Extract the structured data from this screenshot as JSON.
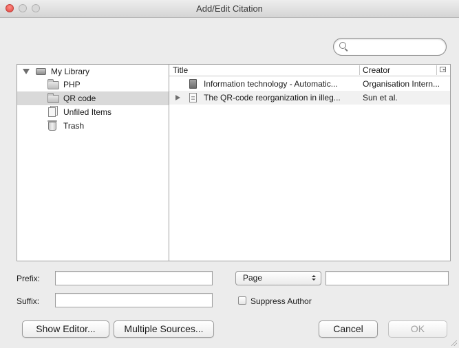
{
  "window": {
    "title": "Add/Edit Citation"
  },
  "search": {
    "value": "",
    "placeholder": ""
  },
  "library_tree": {
    "root": {
      "label": "My Library",
      "icon": "library-icon"
    },
    "items": [
      {
        "label": "PHP",
        "icon": "folder-icon",
        "selected": false
      },
      {
        "label": "QR code",
        "icon": "folder-icon",
        "selected": true
      },
      {
        "label": "Unfiled Items",
        "icon": "unfiled-items-icon",
        "selected": false
      },
      {
        "label": "Trash",
        "icon": "trash-icon",
        "selected": false
      }
    ]
  },
  "items_table": {
    "columns": [
      "Title",
      "Creator"
    ],
    "rows": [
      {
        "title": "Information technology - Automatic...",
        "creator": "Organisation Intern...",
        "icon": "book-icon"
      },
      {
        "title": "The QR-code reorganization in illeg...",
        "creator": "Sun et al.",
        "icon": "document-icon",
        "expandable": true
      }
    ]
  },
  "form": {
    "prefix_label": "Prefix:",
    "prefix_value": "",
    "suffix_label": "Suffix:",
    "suffix_value": "",
    "locator_type": "Page",
    "locator_value": "",
    "suppress_author_label": "Suppress Author",
    "suppress_author_checked": false
  },
  "buttons": {
    "show_editor": "Show Editor...",
    "multiple_sources": "Multiple Sources...",
    "cancel": "Cancel",
    "ok": "OK"
  },
  "colors": {
    "window_bg": "#ececec",
    "selection": "#d9d9d9",
    "close_button": "#e0443e"
  }
}
